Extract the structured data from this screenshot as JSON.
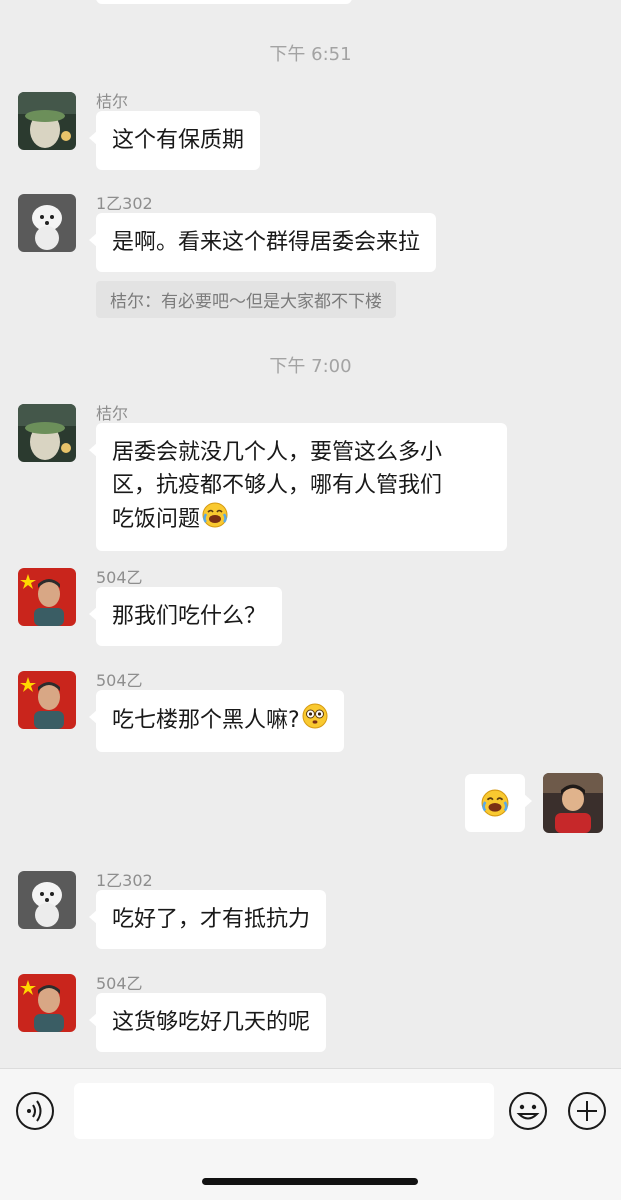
{
  "timestamps": [
    "下午 6:51",
    "下午 7:00"
  ],
  "messages": [
    {
      "sender": "桔尔",
      "text": "这个有保质期"
    },
    {
      "sender": "1乙302",
      "text": "是啊。看来这个群得居委会来拉",
      "quote": "桔尔：有必要吧～但是大家都不下楼"
    },
    {
      "sender": "桔尔",
      "lines": [
        "居委会就没几个人，要管这么多小",
        "区，抗疫都不够人，哪有人管我们",
        "吃饭问题"
      ],
      "emoji": "laughing-crying-emoji"
    },
    {
      "sender": "504乙",
      "text": "那我们吃什么？"
    },
    {
      "sender": "504乙",
      "text": "吃七楼那个黑人嘛?",
      "emoji": "flushed-emoji"
    },
    {
      "sender": "self",
      "emoji": "laughing-crying-emoji"
    },
    {
      "sender": "1乙302",
      "text": "吃好了，才有抵抗力"
    },
    {
      "sender": "504乙",
      "text": "这货够吃好几天的呢"
    }
  ],
  "input_bar": {
    "voice_icon": "voice-icon",
    "emoji_icon": "smiley-icon",
    "plus_icon": "plus-icon"
  },
  "colors": {
    "background": "#ededed",
    "bubble": "#ffffff",
    "timestamp": "#a3a3a3",
    "sender_name": "#8e8e8e"
  }
}
